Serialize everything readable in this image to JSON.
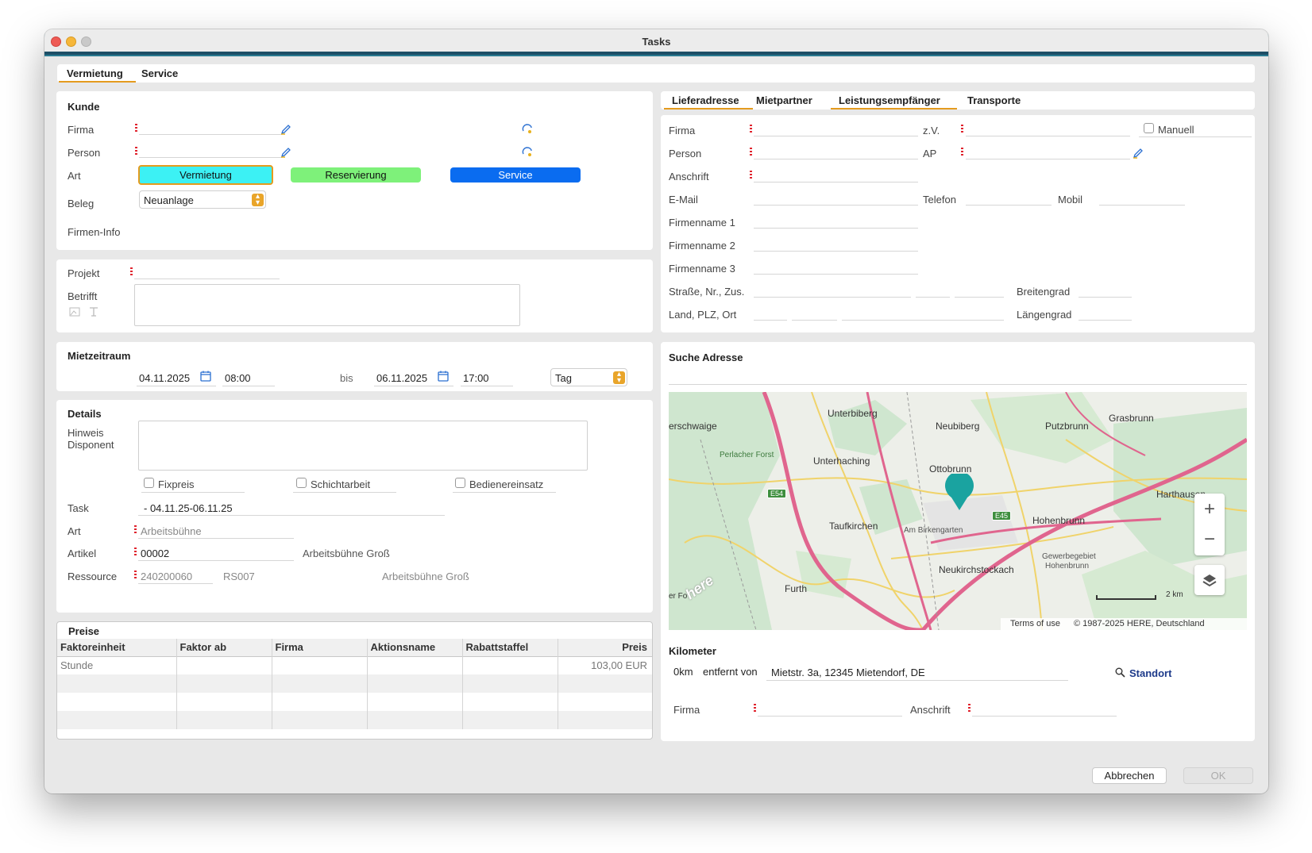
{
  "window": {
    "title": "Tasks"
  },
  "top_tabs": [
    "Vermietung",
    "Service"
  ],
  "kunde": {
    "heading": "Kunde",
    "firma_label": "Firma",
    "person_label": "Person",
    "art_label": "Art",
    "art_buttons": [
      "Vermietung",
      "Reservierung",
      "Service"
    ],
    "beleg_label": "Beleg",
    "beleg_value": "Neuanlage",
    "firmeninfo_label": "Firmen-Info"
  },
  "projekt": {
    "projekt_label": "Projekt",
    "betrifft_label": "Betrifft"
  },
  "mietzeitraum": {
    "heading": "Mietzeitraum",
    "from_date": "04.11.2025",
    "from_time": "08:00",
    "bis_label": "bis",
    "to_date": "06.11.2025",
    "to_time": "17:00",
    "unit": "Tag"
  },
  "details": {
    "heading": "Details",
    "hinweis_label_1": "Hinweis",
    "hinweis_label_2": "Disponent",
    "checkbox_fixpreis": "Fixpreis",
    "checkbox_schicht": "Schichtarbeit",
    "checkbox_bediener": "Bedienereinsatz",
    "task_label": "Task",
    "task_value": "- 04.11.25-06.11.25",
    "art_label": "Art",
    "art_value": "Arbeitsbühne",
    "artikel_label": "Artikel",
    "artikel_value": "00002",
    "artikel_desc": "Arbeitsbühne Groß",
    "ressource_label": "Ressource",
    "ressource_value": "240200060",
    "ressource_code": "RS007",
    "ressource_desc": "Arbeitsbühne Groß"
  },
  "preise": {
    "heading": "Preise",
    "columns": [
      "Faktoreinheit",
      "Faktor ab",
      "Firma",
      "Aktionsname",
      "Rabattstaffel",
      "Preis"
    ],
    "rows": [
      [
        "Stunde",
        "",
        "",
        "",
        "",
        "103,00 EUR"
      ],
      [
        "",
        "",
        "",
        "",
        "",
        ""
      ],
      [
        "",
        "",
        "",
        "",
        "",
        ""
      ],
      [
        "",
        "",
        "",
        "",
        "",
        ""
      ]
    ]
  },
  "right_tabs": [
    "Lieferadresse",
    "Mietpartner",
    "Leistungsempfänger",
    "Transporte"
  ],
  "address": {
    "firma": "Firma",
    "zv": "z.V.",
    "manuell": "Manuell",
    "person": "Person",
    "ap": "AP",
    "anschrift": "Anschrift",
    "email": "E-Mail",
    "telefon": "Telefon",
    "mobil": "Mobil",
    "fn1": "Firmenname 1",
    "fn2": "Firmenname 2",
    "fn3": "Firmenname 3",
    "strasse": "Straße, Nr., Zus.",
    "breitengrad": "Breitengrad",
    "land": "Land, PLZ, Ort",
    "laengengrad": "Längengrad"
  },
  "map_section": {
    "heading": "Suche Adresse",
    "places": [
      "Unterbiberg",
      "Neubiberg",
      "Putzbrunn",
      "Grasbrunn",
      "erschwaige",
      "Perlacher Forst",
      "Unterhaching",
      "Ottobrunn",
      "Harthausen",
      "Taufkirchen",
      "Hohenbrunn",
      "Am Birkengarten",
      "Gewerbegebiet",
      "Hohenbrunn",
      "Neukirchstockach",
      "Furth",
      "er Fo"
    ],
    "roads": [
      "E54",
      "E45"
    ],
    "scale": "2 km",
    "terms": "Terms of use",
    "copyright": "© 1987-2025 HERE, Deutschland",
    "logo": "here",
    "zoom_in": "+",
    "zoom_out": "−"
  },
  "kilometer": {
    "heading": "Kilometer",
    "km": "0km",
    "entfernt": "entfernt von",
    "address": "Mietstr. 3a, 12345 Mietendorf, DE",
    "standort": "Standort",
    "firma": "Firma",
    "anschrift": "Anschrift"
  },
  "footer": {
    "cancel": "Abbrechen",
    "ok": "OK"
  },
  "colors": {
    "accent_tab": "#e49b1e",
    "vermietung": "#3cf1f4",
    "reservierung": "#7ef17a",
    "service": "#0a6cf0",
    "pin": "#1aa3a0"
  }
}
